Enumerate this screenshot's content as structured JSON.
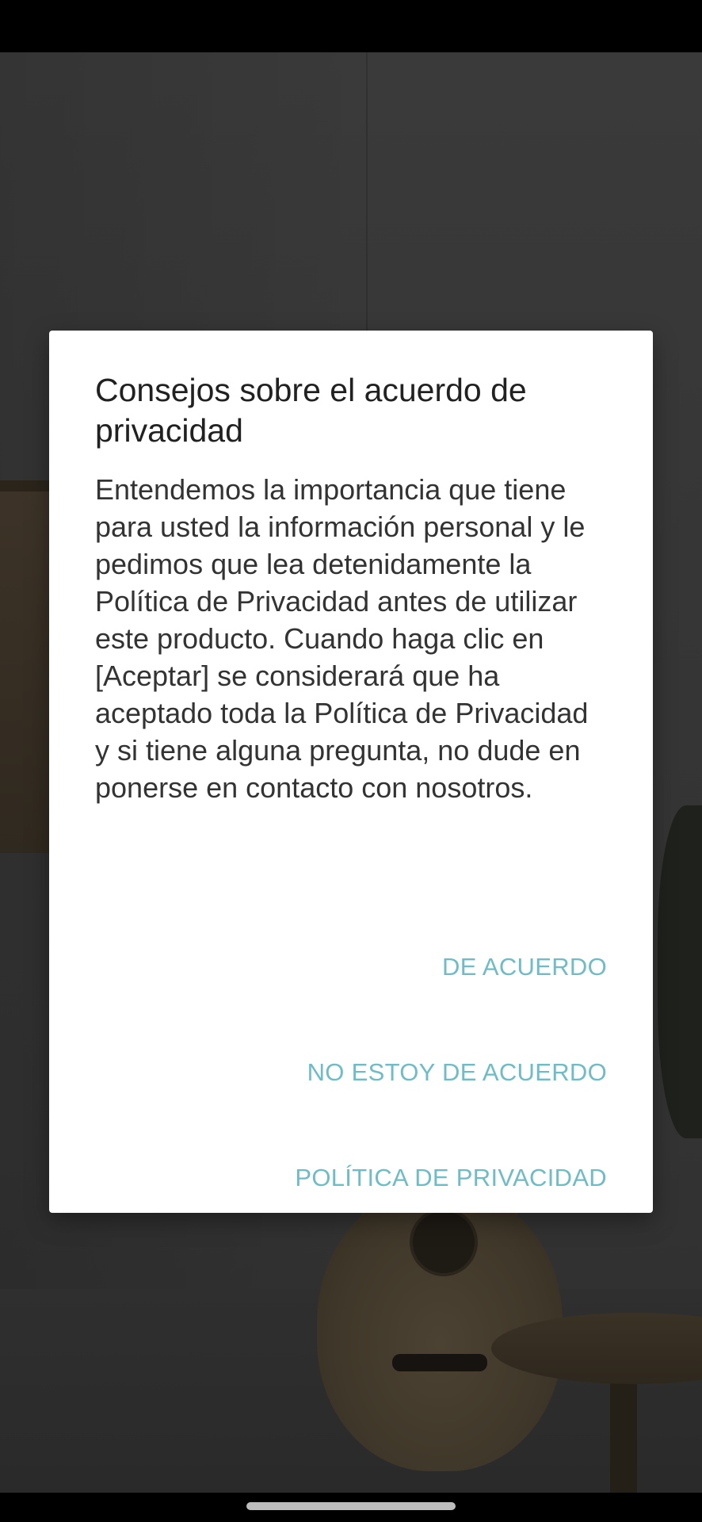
{
  "dialog": {
    "title": "Consejos sobre el acuerdo de privacidad",
    "body": "Entendemos la importancia que tiene para usted la información personal y le pedimos que lea detenidamente la Política de Privacidad antes de utilizar este producto. Cuando haga clic en [Aceptar] se considerará que ha aceptado toda la Política de Privacidad y si tiene alguna pregunta, no dude en ponerse en contacto con nosotros.",
    "actions": {
      "agree_label": "DE ACUERDO",
      "disagree_label": "NO ESTOY DE ACUERDO",
      "privacy_policy_label": "POLÍTICA DE PRIVACIDAD"
    }
  },
  "colors": {
    "accent": "#6cbdc6",
    "dialog_background": "#ffffff",
    "scrim": "#363636",
    "system_bars": "#000000"
  }
}
